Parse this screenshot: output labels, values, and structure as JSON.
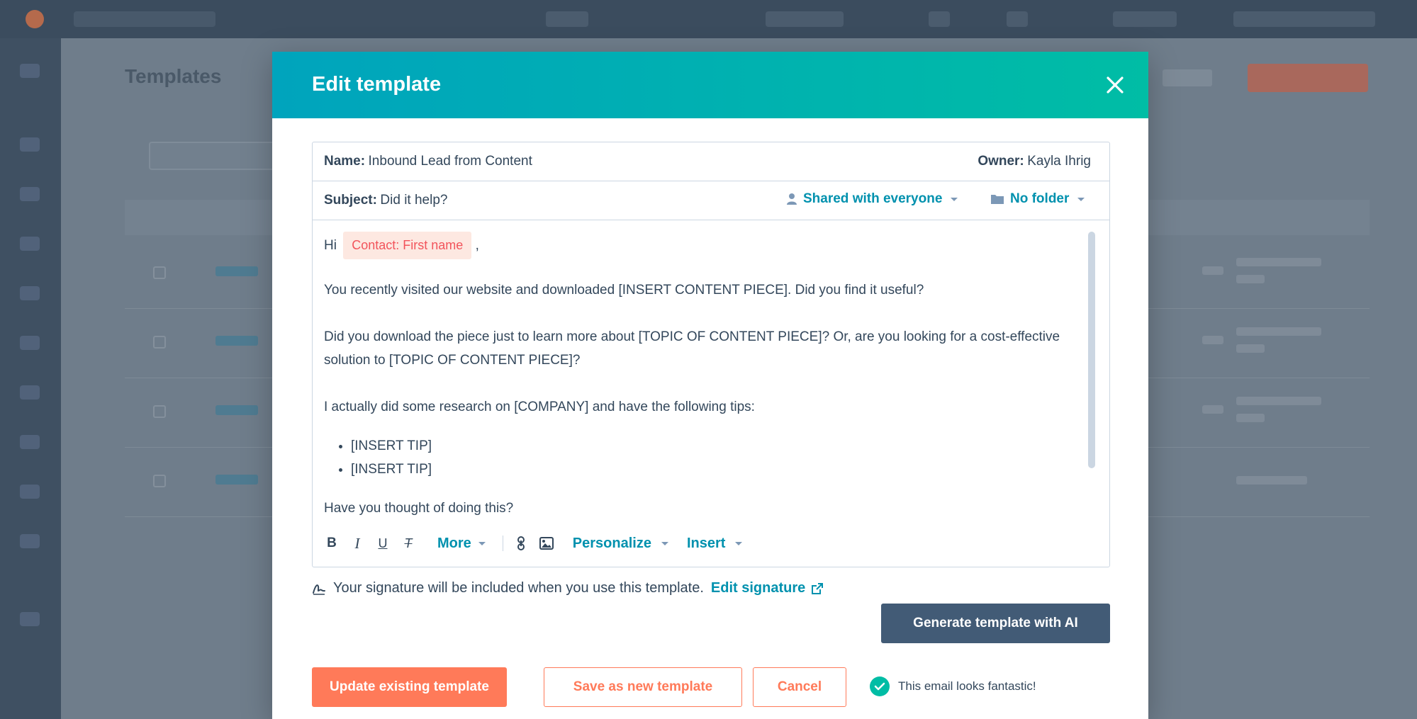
{
  "modal": {
    "title": "Edit template",
    "name_label": "Name:",
    "name_value": "Inbound Lead from Content",
    "owner_label": "Owner:",
    "owner_value": "Kayla Ihrig",
    "subject_label": "Subject:",
    "subject_value": "Did it help?",
    "sharing": "Shared with everyone",
    "folder": "No folder",
    "body": {
      "greeting": "Hi",
      "token": "Contact: First name",
      "comma": ",",
      "p1": "You recently visited our website and downloaded [INSERT CONTENT PIECE]. Did you find it useful?",
      "p2": "Did you download the piece just to learn more about [TOPIC OF CONTENT PIECE]? Or, are you looking for a cost-effective solution to [TOPIC OF CONTENT PIECE]?",
      "p3": "I actually did some research on [COMPANY] and have the following tips:",
      "bullets": [
        "[INSERT TIP]",
        "[INSERT TIP]"
      ],
      "p4": "Have you thought of doing this?"
    },
    "toolbar": {
      "more": "More",
      "personalize": "Personalize",
      "insert": "Insert"
    },
    "signature_text": "Your signature will be included when you use this template.",
    "edit_signature": "Edit signature",
    "generate_ai": "Generate template with AI",
    "update_existing": "Update existing template",
    "save_new": "Save as new template",
    "cancel": "Cancel",
    "status": "This email looks fantastic!"
  },
  "background": {
    "page_title": "Templates"
  },
  "colors": {
    "header_gradient_start": "#00a4bd",
    "header_gradient_end": "#00bda5",
    "accent_orange": "#ff7a59",
    "link_teal": "#0091ae",
    "dark_button": "#425b76",
    "token_bg": "#fde8e1",
    "token_text": "#f2545b"
  }
}
